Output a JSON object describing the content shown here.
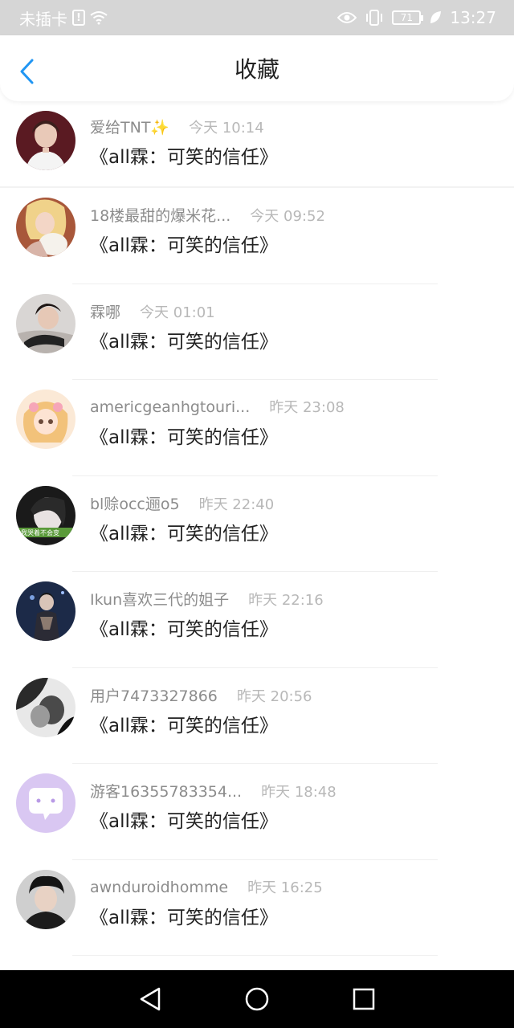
{
  "status_bar": {
    "carrier": "未插卡",
    "battery": "71",
    "time": "13:27"
  },
  "header": {
    "title": "收藏",
    "back_icon": "chevron-left-icon"
  },
  "colors": {
    "accent": "#2196f3",
    "status_bar_bg": "#d6d6d6",
    "name_text": "#8c8c8c",
    "time_text": "#b8b8b8"
  },
  "items": [
    {
      "name": "爱给TNT✨",
      "time": "今天 10:14",
      "content": "《all霖：可笑的信任》"
    },
    {
      "name": "18楼最甜的爆米花...",
      "time": "今天 09:52",
      "content": "《all霖：可笑的信任》"
    },
    {
      "name": "霖哪",
      "time": "今天 01:01",
      "content": "《all霖：可笑的信任》"
    },
    {
      "name": "americgeanhgtouri...",
      "time": "昨天 23:08",
      "content": "《all霖：可笑的信任》"
    },
    {
      "name": "bl赊occ逦o5",
      "time": "昨天 22:40",
      "content": "《all霖：可笑的信任》"
    },
    {
      "name": "Ikun喜欢三代的姐子",
      "time": "昨天 22:16",
      "content": "《all霖：可笑的信任》"
    },
    {
      "name": "用户7473327866",
      "time": "昨天 20:56",
      "content": "《all霖：可笑的信任》"
    },
    {
      "name": "游客16355783354...",
      "time": "昨天 18:48",
      "content": "《all霖：可笑的信任》"
    },
    {
      "name": "awnduroidhomme",
      "time": "昨天 16:25",
      "content": "《all霖：可笑的信任》"
    }
  ],
  "avatar_caption": "我哭着不会变",
  "system_nav": {
    "back_icon": "triangle-back-icon",
    "home_icon": "circle-home-icon",
    "recents_icon": "square-recents-icon"
  }
}
